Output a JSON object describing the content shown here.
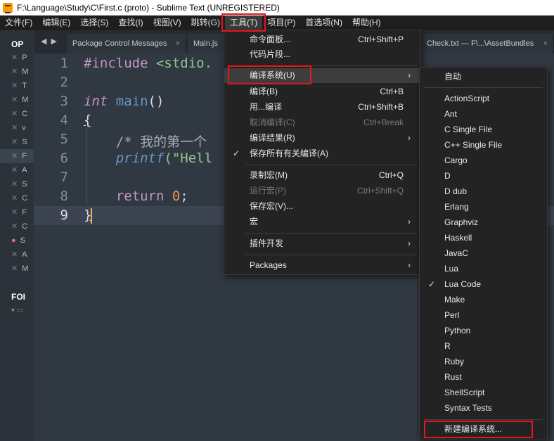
{
  "window": {
    "title": "F:\\Language\\Study\\C\\First.c (proto) - Sublime Text (UNREGISTERED)"
  },
  "menubar": [
    {
      "label": "文件(F)"
    },
    {
      "label": "编辑(E)"
    },
    {
      "label": "选择(S)"
    },
    {
      "label": "查找(I)"
    },
    {
      "label": "视图(V)"
    },
    {
      "label": "跳转(G)"
    },
    {
      "label": "工具(T)"
    },
    {
      "label": "项目(P)"
    },
    {
      "label": "首选项(N)"
    },
    {
      "label": "帮助(H)"
    }
  ],
  "sidebar": {
    "header": "OP",
    "files": [
      {
        "label": "P"
      },
      {
        "label": "M"
      },
      {
        "label": "T"
      },
      {
        "label": "M"
      },
      {
        "label": "C"
      },
      {
        "label": "v"
      },
      {
        "label": "S"
      },
      {
        "label": "F"
      },
      {
        "label": "A"
      },
      {
        "label": "S"
      },
      {
        "label": "C"
      },
      {
        "label": "F"
      },
      {
        "label": "C"
      },
      {
        "label": "S"
      },
      {
        "label": "A"
      },
      {
        "label": "M"
      }
    ],
    "folders_header": "FOI"
  },
  "tabs": [
    {
      "label": "Package Control Messages",
      "close": "×"
    },
    {
      "label": "Main.js",
      "close": ""
    },
    {
      "label": "Check.txt — F\\...\\AssetBundles",
      "close": "×"
    }
  ],
  "editor": {
    "line_numbers": [
      "1",
      "2",
      "3",
      "4",
      "5",
      "6",
      "7",
      "8",
      "9"
    ],
    "lines": {
      "l1_inc": "#include",
      "l1_str": " <stdio.",
      "l3_type": "int",
      "l3_fn": " main",
      "l3_paren": "()",
      "l4": "{",
      "l5": "    /* 我的第一个",
      "l6_fn": "    printf",
      "l6_rest": "(\"Hell",
      "l8_kw": "    return",
      "l8_num": " 0",
      "l8_semi": ";",
      "l9": "}"
    }
  },
  "tools_menu": {
    "items": [
      {
        "label": "命令面板...",
        "shortcut": "Ctrl+Shift+P"
      },
      {
        "label": "代码片段...",
        "shortcut": ""
      },
      {
        "label": "编译系统(U)",
        "shortcut": "",
        "arrow": "›"
      },
      {
        "label": "编译(B)",
        "shortcut": "Ctrl+B"
      },
      {
        "label": "用...编译",
        "shortcut": "Ctrl+Shift+B"
      },
      {
        "label": "取消编译(C)",
        "shortcut": "Ctrl+Break"
      },
      {
        "label": "编译结果(R)",
        "shortcut": "",
        "arrow": "›"
      },
      {
        "label": "保存所有有关编译(A)",
        "shortcut": "",
        "check": "✓"
      },
      {
        "label": "录制宏(M)",
        "shortcut": "Ctrl+Q"
      },
      {
        "label": "运行宏(P)",
        "shortcut": "Ctrl+Shift+Q"
      },
      {
        "label": "保存宏(V)...",
        "shortcut": ""
      },
      {
        "label": "宏",
        "shortcut": "",
        "arrow": "›"
      },
      {
        "label": "插件开发",
        "shortcut": "",
        "arrow": "›"
      },
      {
        "label": "Packages",
        "shortcut": "",
        "arrow": "›"
      }
    ]
  },
  "build_menu": {
    "items": [
      {
        "label": "自动"
      },
      {
        "label": "ActionScript"
      },
      {
        "label": "Ant"
      },
      {
        "label": "C Single File"
      },
      {
        "label": "C++ Single File"
      },
      {
        "label": "Cargo"
      },
      {
        "label": "D"
      },
      {
        "label": "D dub"
      },
      {
        "label": "Erlang"
      },
      {
        "label": "Graphviz"
      },
      {
        "label": "Haskell"
      },
      {
        "label": "JavaC"
      },
      {
        "label": "Lua"
      },
      {
        "label": "Lua Code",
        "check": "✓"
      },
      {
        "label": "Make"
      },
      {
        "label": "Perl"
      },
      {
        "label": "Python"
      },
      {
        "label": "R"
      },
      {
        "label": "Ruby"
      },
      {
        "label": "Rust"
      },
      {
        "label": "ShellScript"
      },
      {
        "label": "Syntax Tests"
      },
      {
        "label": "新建编译系统..."
      }
    ]
  },
  "colors": {
    "highlight_box": "#e8151b",
    "editor_bg": "#303841",
    "menu_bg": "#232323"
  }
}
